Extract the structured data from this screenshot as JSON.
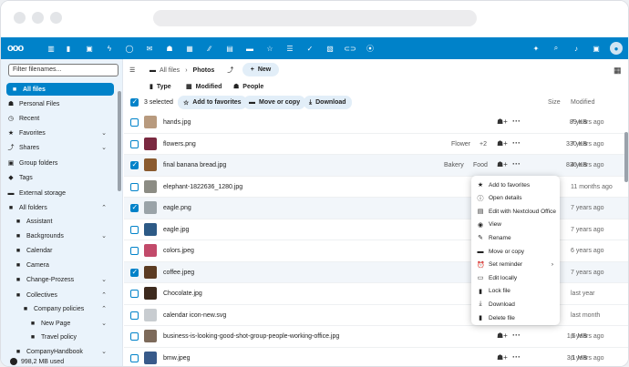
{
  "search": {
    "placeholder": "Filter filenames..."
  },
  "sidebar": {
    "items": [
      {
        "label": "All files",
        "icon": "folder-icon",
        "active": true
      },
      {
        "label": "Personal Files",
        "icon": "user-icon"
      },
      {
        "label": "Recent",
        "icon": "clock-icon"
      },
      {
        "label": "Favorites",
        "icon": "star-icon",
        "chevron": "⌄"
      },
      {
        "label": "Shares",
        "icon": "share-icon",
        "chevron": "⌄"
      },
      {
        "label": "Group folders",
        "icon": "group-folder-icon"
      },
      {
        "label": "Tags",
        "icon": "tag-icon"
      },
      {
        "label": "External storage",
        "icon": "external-storage-icon"
      },
      {
        "label": "All folders",
        "icon": "folder-icon",
        "chevron": "⌃"
      },
      {
        "label": "Assistant",
        "icon": "folder-icon"
      },
      {
        "label": "Backgrounds",
        "icon": "folder-icon",
        "chevron": "⌄"
      },
      {
        "label": "Calendar",
        "icon": "folder-icon"
      },
      {
        "label": "Camera",
        "icon": "folder-icon"
      },
      {
        "label": "Change-Prozess",
        "icon": "folder-icon",
        "chevron": "⌄"
      },
      {
        "label": "Collectives",
        "icon": "folder-icon",
        "chevron": "⌃"
      },
      {
        "label": "Company policies",
        "icon": "folder-icon",
        "chevron": "⌃"
      },
      {
        "label": "New Page",
        "icon": "folder-icon",
        "chevron": "⌄"
      },
      {
        "label": "Travel policy",
        "icon": "folder-icon"
      },
      {
        "label": "CompanyHandbook",
        "icon": "folder-icon",
        "chevron": "⌄"
      }
    ],
    "quota": "998,2 MB used"
  },
  "breadcrumb": {
    "root": "All files",
    "current": "Photos",
    "new_label": "New"
  },
  "filters": {
    "type": "Type",
    "modified": "Modified",
    "people": "People"
  },
  "selection": {
    "count": "3 selected",
    "add_favorites": "Add to favorites",
    "move_copy": "Move or copy",
    "download": "Download",
    "size_header": "Size",
    "modified_header": "Modified"
  },
  "files": [
    {
      "name": "hands.jpg",
      "size": "89 KB",
      "modified": "7 years ago",
      "selected": false,
      "thumb": "#b89a7e",
      "tags": []
    },
    {
      "name": "flowers.png",
      "size": "330 KB",
      "modified": "7 years ago",
      "selected": false,
      "thumb": "#7a2940",
      "tags": [
        "Flower",
        "+2"
      ]
    },
    {
      "name": "final banana bread.jpg",
      "size": "836 KB",
      "modified": "4 years ago",
      "selected": true,
      "thumb": "#8a5a2e",
      "tags": [
        "Bakery",
        "Food"
      ]
    },
    {
      "name": "elephant-1822636_1280.jpg",
      "size": "",
      "modified": "11 months ago",
      "selected": false,
      "thumb": "#8c8c84",
      "tags": []
    },
    {
      "name": "eagle.png",
      "size": "",
      "modified": "7 years ago",
      "selected": true,
      "thumb": "#9aa3a8",
      "tags": []
    },
    {
      "name": "eagle.jpg",
      "size": "",
      "modified": "7 years ago",
      "selected": false,
      "thumb": "#2d5a86",
      "tags": []
    },
    {
      "name": "colors.jpeg",
      "size": "",
      "modified": "6 years ago",
      "selected": false,
      "thumb": "#c24a6a",
      "tags": []
    },
    {
      "name": "coffee.jpeg",
      "size": "",
      "modified": "7 years ago",
      "selected": true,
      "thumb": "#5b3b22",
      "tags": []
    },
    {
      "name": "Chocolate.jpg",
      "size": "",
      "modified": "last year",
      "selected": false,
      "thumb": "#3d2a1e",
      "tags": []
    },
    {
      "name": "calendar icon-new.svg",
      "size": "",
      "modified": "last month",
      "selected": false,
      "thumb": "#c8ccd0",
      "tags": []
    },
    {
      "name": "business-is-looking-good-shot-group-people-working-office.jpg",
      "size": "1,6 MB",
      "modified": "6 years ago",
      "selected": false,
      "thumb": "#7d6a5a",
      "tags": []
    },
    {
      "name": "bmw.jpeg",
      "size": "3,1 MB",
      "modified": "6 years ago",
      "selected": false,
      "thumb": "#385a8a",
      "tags": []
    }
  ],
  "context_menu": [
    {
      "label": "Add to favorites",
      "icon": "star-icon"
    },
    {
      "label": "Open details",
      "icon": "info-icon"
    },
    {
      "label": "Edit with Nextcloud Office",
      "icon": "office-icon"
    },
    {
      "label": "View",
      "icon": "eye-icon"
    },
    {
      "label": "Rename",
      "icon": "pencil-icon"
    },
    {
      "label": "Move or copy",
      "icon": "folder-move-icon"
    },
    {
      "label": "Set reminder",
      "icon": "alarm-icon",
      "arrow": "›"
    },
    {
      "label": "Edit locally",
      "icon": "laptop-icon"
    },
    {
      "label": "Lock file",
      "icon": "lock-icon"
    },
    {
      "label": "Download",
      "icon": "download-icon"
    },
    {
      "label": "Delete file",
      "icon": "trash-icon"
    }
  ],
  "colors": {
    "brand": "#0082c9",
    "sidebar_bg": "#eaf3fb"
  }
}
